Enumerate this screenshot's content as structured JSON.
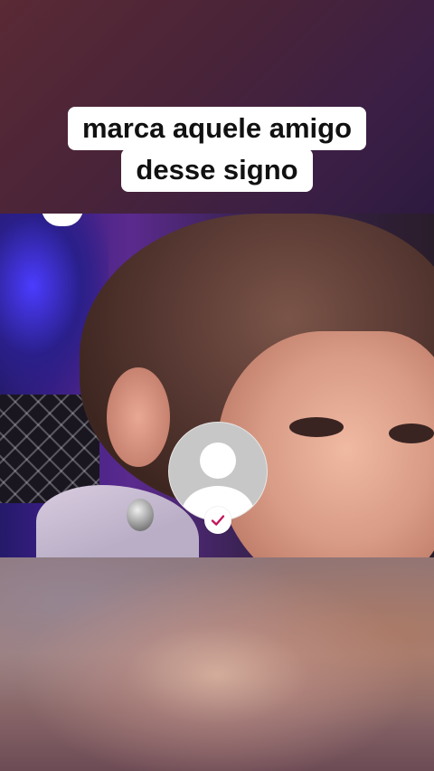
{
  "caption": {
    "line1": "marca aquele amigo",
    "line2": "desse signo"
  },
  "icons": {
    "avatar": "default-profile-avatar-icon",
    "check": "checkmark-icon"
  },
  "colors": {
    "caption_bg": "#ffffff",
    "caption_text": "#111111",
    "check_accent": "#c2185b",
    "avatar_bg": "#c7c7c7"
  }
}
